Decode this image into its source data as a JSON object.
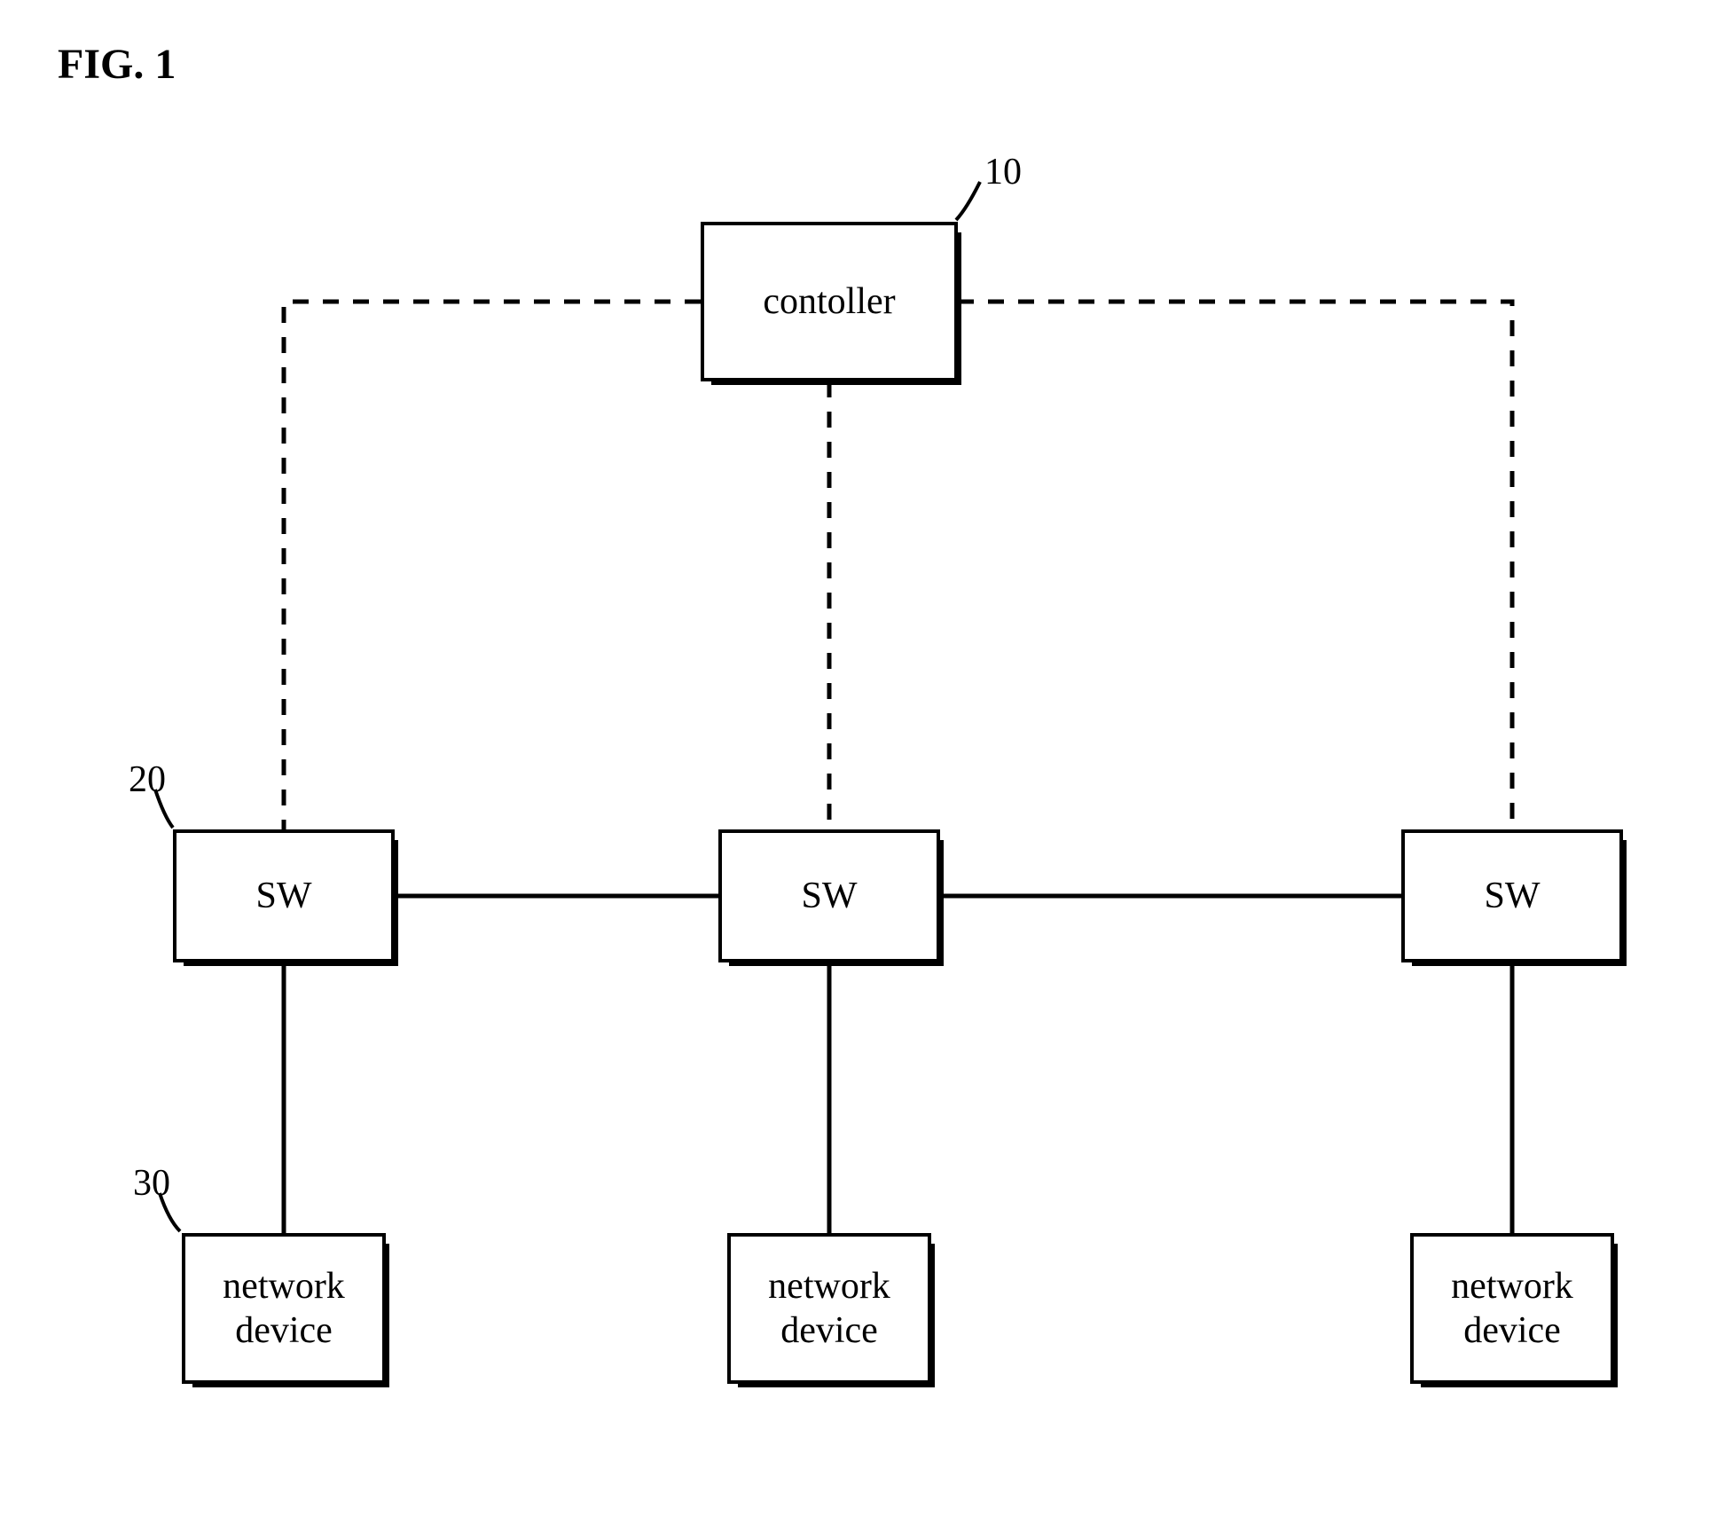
{
  "figure_label": "FIG. 1",
  "nodes": {
    "controller": {
      "label": "contoller",
      "ref": "10"
    },
    "sw1": {
      "label": "SW",
      "ref": "20"
    },
    "sw2": {
      "label": "SW"
    },
    "sw3": {
      "label": "SW"
    },
    "nd1": {
      "label": "network\ndevice",
      "ref": "30"
    },
    "nd2": {
      "label": "network\ndevice"
    },
    "nd3": {
      "label": "network\ndevice"
    }
  },
  "ref_labels": {
    "r10": "10",
    "r20": "20",
    "r30": "30"
  }
}
